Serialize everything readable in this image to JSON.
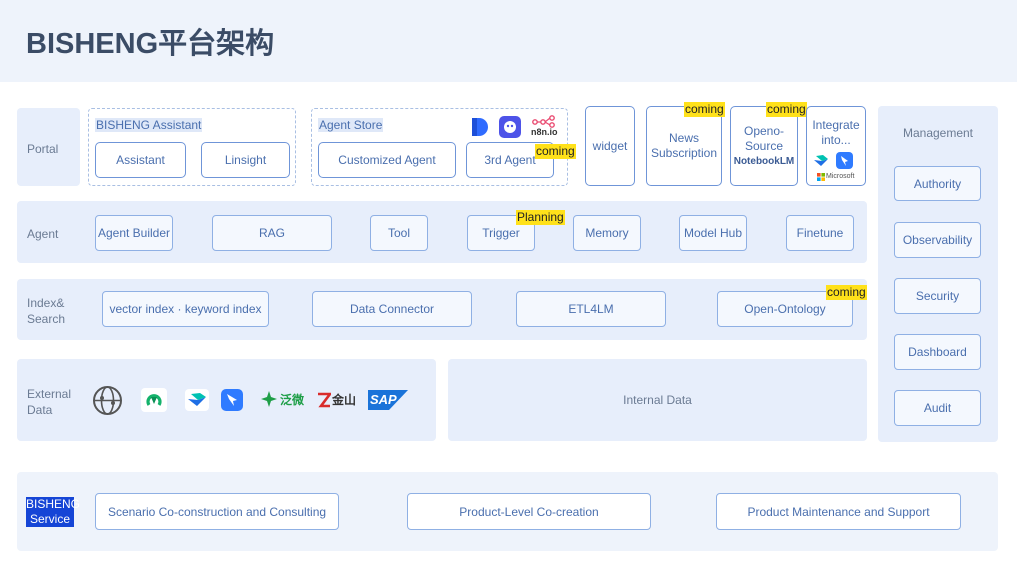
{
  "title": "BISHENG平台架构",
  "portal": {
    "label": "Portal",
    "assistant_group": "BISHENG Assistant",
    "assistant": "Assistant",
    "linsight": "Linsight",
    "store_group": "Agent Store",
    "customized_agent": "Customized Agent",
    "third_agent": "3rd Agent",
    "third_agent_tag": "coming",
    "n8n_label": "n8n.io",
    "widget": "widget",
    "news_line1": "News",
    "news_line2": "Subscription",
    "news_tag": "coming",
    "openo_line1": "Openo-",
    "openo_line2": "Source",
    "openo_line3": "NotebookLM",
    "openo_tag": "coming",
    "integrate_line1": "Integrate",
    "integrate_line2": "into...",
    "microsoft_label": "Microsoft"
  },
  "agent": {
    "label": "Agent",
    "items": [
      "Agent Builder",
      "RAG",
      "Tool",
      "Trigger",
      "Memory",
      "Model Hub",
      "Finetune"
    ],
    "trigger_tag": "Planning"
  },
  "index": {
    "label_line1": "Index&",
    "label_line2": "Search",
    "items": [
      "vector index · keyword index",
      "Data Connector",
      "ETL4LM",
      "Open-Ontology"
    ],
    "ontology_tag": "coming"
  },
  "external": {
    "label_line1": "External",
    "label_line2": "Data",
    "logos": [
      "globe-icon",
      "green-app-icon",
      "lark-icon",
      "dingtalk-icon",
      "weaver-icon",
      "kingdee-icon",
      "sap-icon"
    ],
    "weaver_text": "泛微",
    "kingdee_text": "金山",
    "sap_text": "SAP"
  },
  "internal": {
    "label": "Internal Data"
  },
  "management": {
    "label": "Management",
    "items": [
      "Authority",
      "Observability",
      "Security",
      "Dashboard",
      "Audit"
    ]
  },
  "service": {
    "label_line1": "BISHENG",
    "label_line2": "Service",
    "items": [
      "Scenario Co-construction and Consulting",
      "Product-Level Co-creation",
      "Product Maintenance and Support"
    ]
  }
}
